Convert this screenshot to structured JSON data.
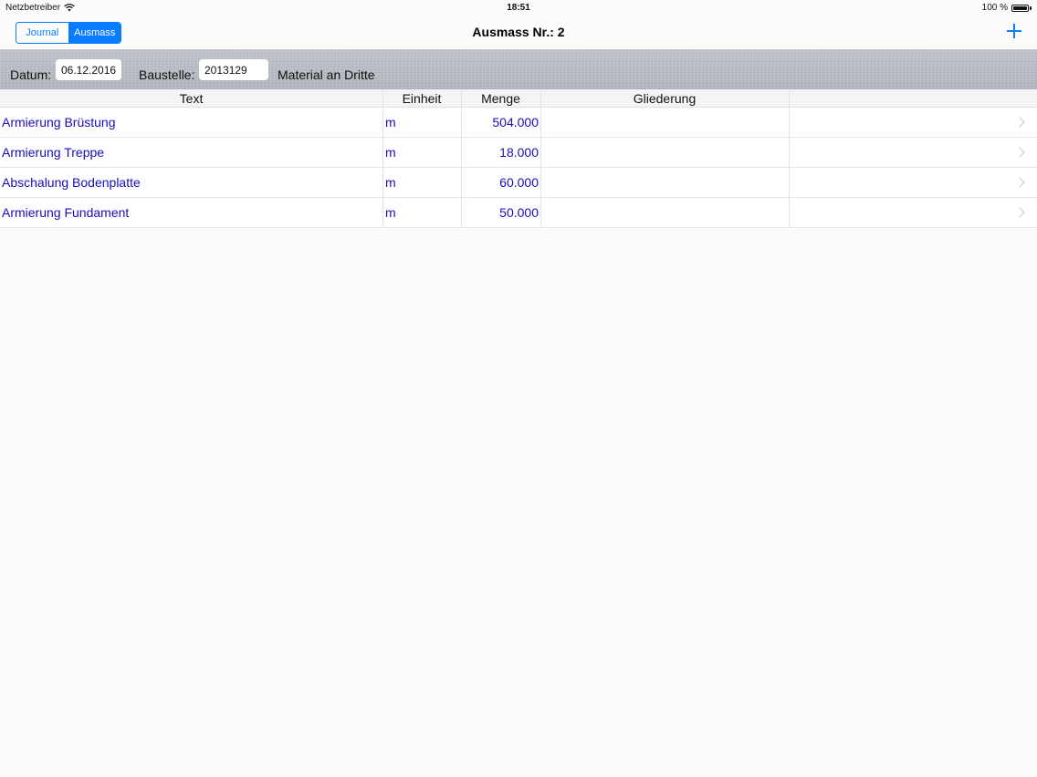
{
  "status_bar": {
    "carrier": "Netzbetreiber",
    "time": "18:51",
    "battery": "100 %"
  },
  "nav": {
    "segments": [
      "Journal",
      "Ausmass"
    ],
    "active_segment": "Ausmass",
    "title": "Ausmass Nr.: 2",
    "add_icon": "plus-icon",
    "accent_color": "#0a7cff"
  },
  "info": {
    "datum_label": "Datum:",
    "datum_value": "06.12.2016",
    "baustelle_label": "Baustelle:",
    "baustelle_value": "2013129",
    "material_label": "Material an Dritte"
  },
  "table": {
    "headers": [
      "Text",
      "Einheit",
      "Menge",
      "Gliederung"
    ],
    "rows": [
      {
        "text": "Armierung Brüstung",
        "einheit": "m",
        "menge": "504.000",
        "gliederung": ""
      },
      {
        "text": "Armierung Treppe",
        "einheit": "m",
        "menge": "18.000",
        "gliederung": ""
      },
      {
        "text": "Abschalung Bodenplatte",
        "einheit": "m",
        "menge": "60.000",
        "gliederung": ""
      },
      {
        "text": "Armierung Fundament",
        "einheit": "m",
        "menge": "50.000",
        "gliederung": ""
      }
    ],
    "cell_text_color": "#1a0dbf"
  }
}
